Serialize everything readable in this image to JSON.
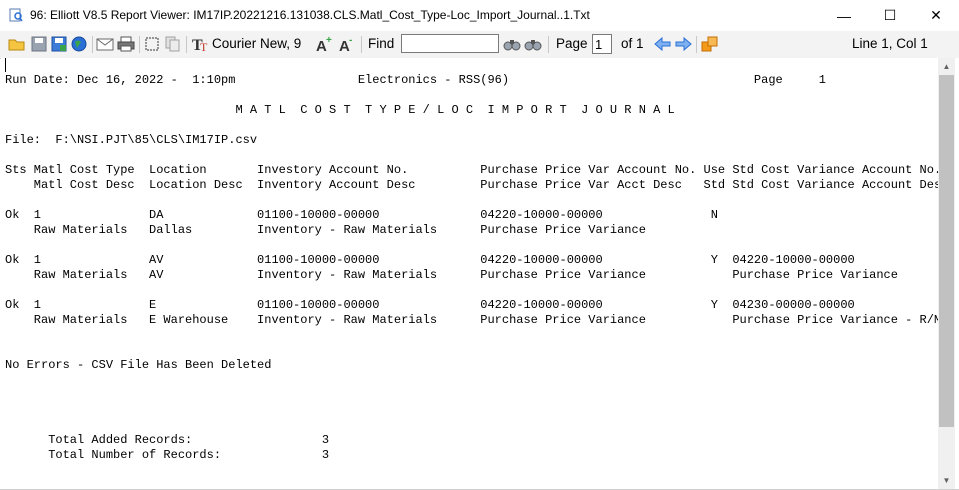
{
  "window": {
    "title": "96: Elliott V8.5 Report Viewer: IM17IP.20221216.131038.CLS.Matl_Cost_Type-Loc_Import_Journal..1.Txt",
    "minimize_glyph": "—",
    "maximize_glyph": "☐",
    "close_glyph": "✕"
  },
  "toolbar": {
    "font_label": "Courier New, 9",
    "find_label": "Find",
    "find_value": "",
    "page_label": "Page",
    "page_value": "1",
    "page_of": "of 1",
    "cursor_position": "Line 1, Col 1",
    "icons": [
      "open-folder-icon",
      "save-icon",
      "save-as-icon",
      "globe-icon",
      "email-icon",
      "print-icon",
      "select-all-icon",
      "copy-icon",
      "font-icon",
      "zoom-in-icon",
      "zoom-out-icon",
      "find-next-icon",
      "find-previous-icon",
      "previous-page-icon",
      "next-page-icon",
      "export-icon"
    ]
  },
  "report": {
    "lines": [
      "Run Date: Dec 16, 2022 -  1:10pm                 Electronics - RSS(96)                                  Page     1",
      "",
      "                                M A T L  C O S T  T Y P E / L O C  I M P O R T  J O U R N A L",
      "",
      "File:  F:\\NSI.PJT\\85\\CLS\\IM17IP.csv",
      "",
      "Sts Matl Cost Type  Location       Investory Account No.          Purchase Price Var Account No. Use Std Cost Variance Account No.",
      "    Matl Cost Desc  Location Desc  Inventory Account Desc         Purchase Price Var Acct Desc   Std Std Cost Variance Account Desc",
      "",
      "Ok  1               DA             01100-10000-00000              04220-10000-00000               N",
      "    Raw Materials   Dallas         Inventory - Raw Materials      Purchase Price Variance",
      "",
      "Ok  1               AV             01100-10000-00000              04220-10000-00000               Y  04220-10000-00000",
      "    Raw Materials   AV             Inventory - Raw Materials      Purchase Price Variance            Purchase Price Variance",
      "",
      "Ok  1               E              01100-10000-00000              04220-10000-00000               Y  04230-00000-00000",
      "    Raw Materials   E Warehouse    Inventory - Raw Materials      Purchase Price Variance            Purchase Price Variance - R/M",
      "",
      "",
      "No Errors - CSV File Has Been Deleted",
      "",
      "",
      "",
      "",
      "      Total Added Records:                  3",
      "      Total Number of Records:              3"
    ]
  },
  "colors": {
    "toolbar_bg": "#f3f3f3",
    "scrollbar_track": "#f0f0f0",
    "scrollbar_thumb": "#c1c1c1",
    "icon_blue": "#2a6fd6",
    "icon_orange": "#f39a1b"
  }
}
